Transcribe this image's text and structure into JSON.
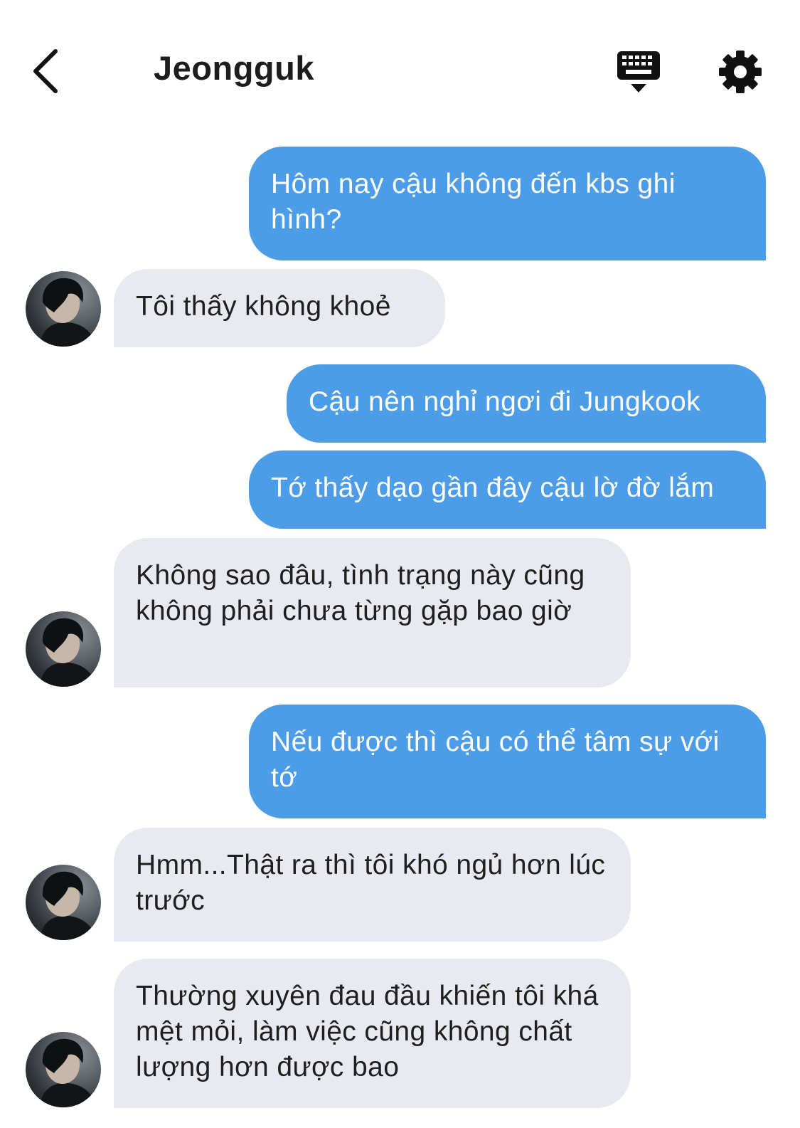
{
  "header": {
    "title": "Jeongguk",
    "back_icon": "chevron-left-icon",
    "keyboard_icon": "keyboard-icon",
    "settings_icon": "gear-icon"
  },
  "colors": {
    "outgoing_bubble": "#4c9ce8",
    "incoming_bubble": "#e8eaef",
    "title": "#1d1d1f"
  },
  "messages": [
    {
      "direction": "out",
      "text": "Hôm nay cậu không đến kbs ghi hình?"
    },
    {
      "direction": "in",
      "text": "Tôi thấy không khoẻ"
    },
    {
      "direction": "out",
      "text": "Cậu nên nghỉ ngơi đi Jungkook"
    },
    {
      "direction": "out",
      "text": "Tớ thấy dạo gần đây cậu lờ đờ lắm"
    },
    {
      "direction": "in",
      "text": "Không sao đâu, tình trạng này cũng không phải chưa từng gặp bao giờ"
    },
    {
      "direction": "out",
      "text": "Nếu được thì cậu có thể tâm sự với tớ"
    },
    {
      "direction": "in",
      "text": "Hmm...Thật ra thì tôi khó ngủ hơn lúc trước"
    },
    {
      "direction": "in",
      "text": "Thường xuyên đau đầu khiến tôi khá mệt mỏi, làm việc cũng không chất lượng hơn được bao"
    }
  ]
}
